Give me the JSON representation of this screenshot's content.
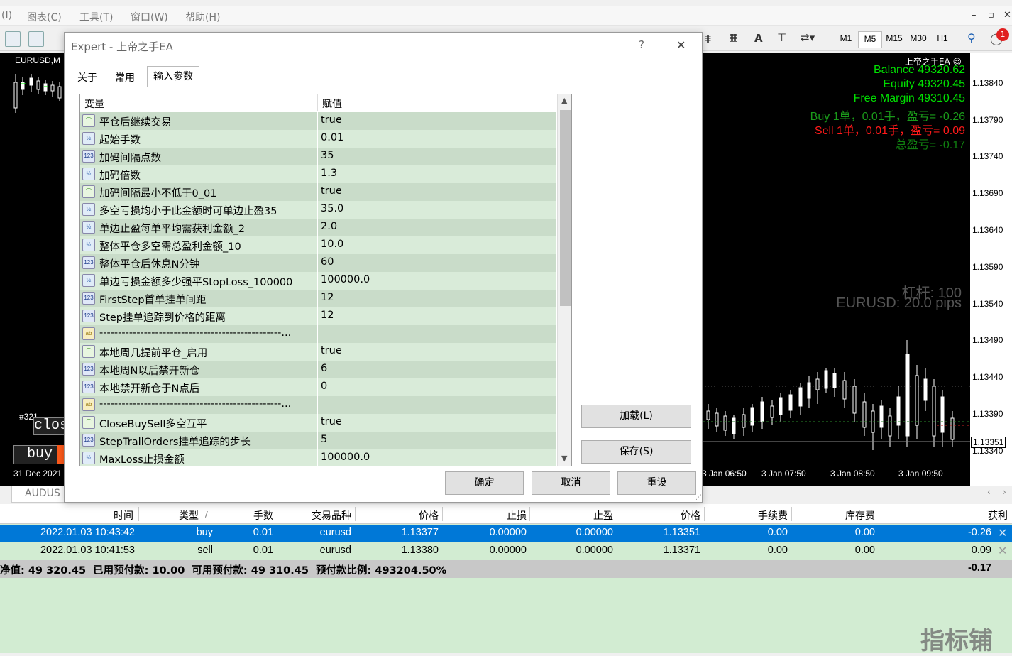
{
  "menubar": {
    "items": [
      "(I)",
      "图表(C)",
      "工具(T)",
      "窗口(W)",
      "帮助(H)"
    ]
  },
  "toolbar": {
    "timeframes": [
      "M1",
      "M5",
      "M15",
      "M30",
      "H1"
    ],
    "active_timeframe": "M5",
    "notification_count": "1"
  },
  "chart": {
    "symbol_label": "EURUSD,M",
    "ea_label": "上帝之手EA ☺",
    "hud": {
      "balance": "Balance 49320.62",
      "equity": "Equity 49320.45",
      "free_margin": "Free Margin 49310.45",
      "buy_line": "Buy 1单，0.01手，盈亏= -0.26",
      "sell_line": "Sell 1单，0.01手，盈亏= 0.09",
      "total_line": "总盈亏= -0.17",
      "leverage": "杠杆: 100",
      "spread": "EURUSD: 20.0 pips"
    },
    "price_ticks": [
      "1.13840",
      "1.13790",
      "1.13740",
      "1.13690",
      "1.13640",
      "1.13590",
      "1.13540",
      "1.13490",
      "1.13440",
      "1.13390",
      "1.13351",
      "1.13340"
    ],
    "time_ticks": [
      "3 Jan 06:50",
      "3 Jan 07:50",
      "3 Jan 08:50",
      "3 Jan 09:50"
    ],
    "left_time_label": "31 Dec 2021",
    "left_order_label": "#321",
    "left_close_btn": "close",
    "left_buy_btn": "buy",
    "bottom_tab": "AUDUS",
    "colors": {
      "balance": "#00e000",
      "buy": "#1a9a1a",
      "sell": "#ff1a1a",
      "total": "#108010",
      "axis_text": "#000000"
    }
  },
  "dialog": {
    "title": "Expert - 上帝之手EA",
    "help": "?",
    "close": "✕",
    "tabs": [
      "关于",
      "常用",
      "输入参数"
    ],
    "active_tab": "输入参数",
    "columns": {
      "variable": "变量",
      "value": "赋值"
    },
    "params": [
      {
        "icon": "bool-icon",
        "name": "平仓后继续交易",
        "value": "true"
      },
      {
        "icon": "double-icon",
        "name": "起始手数",
        "value": "0.01"
      },
      {
        "icon": "int-icon",
        "name": "加码间隔点数",
        "value": "35"
      },
      {
        "icon": "double-icon",
        "name": "加码倍数",
        "value": "1.3"
      },
      {
        "icon": "bool-icon",
        "name": "加码间隔最小不低于0_01",
        "value": "true"
      },
      {
        "icon": "double-icon",
        "name": "多空亏损均小于此金额时可单边止盈35",
        "value": "35.0"
      },
      {
        "icon": "double-icon",
        "name": "单边止盈每单平均需获利金额_2",
        "value": "2.0"
      },
      {
        "icon": "double-icon",
        "name": "整体平仓多空需总盈利金额_10",
        "value": "10.0"
      },
      {
        "icon": "int-icon",
        "name": "整体平仓后休息N分钟",
        "value": "60"
      },
      {
        "icon": "double-icon",
        "name": "单边亏损金额多少强平StopLoss_100000",
        "value": "100000.0"
      },
      {
        "icon": "int-icon",
        "name": "FirstStep首单挂单间距",
        "value": "12"
      },
      {
        "icon": "int-icon",
        "name": "Step挂单追踪到价格的距离",
        "value": "12"
      },
      {
        "icon": "string-icon",
        "name": "-------------------------------------------------...",
        "value": ""
      },
      {
        "icon": "bool-icon",
        "name": "本地周几提前平仓_启用",
        "value": "true"
      },
      {
        "icon": "int-icon",
        "name": "本地周N以后禁开新仓",
        "value": "6"
      },
      {
        "icon": "int-icon",
        "name": "本地禁开新仓于N点后",
        "value": "0"
      },
      {
        "icon": "string-icon",
        "name": "-------------------------------------------------...",
        "value": ""
      },
      {
        "icon": "bool-icon",
        "name": "CloseBuySell多空互平",
        "value": "true"
      },
      {
        "icon": "int-icon",
        "name": "StepTrallOrders挂单追踪的步长",
        "value": "5"
      },
      {
        "icon": "double-icon",
        "name": "MaxLoss止损金额",
        "value": "100000.0"
      }
    ],
    "buttons": {
      "load": "加载(L)",
      "save": "保存(S)",
      "ok": "确定",
      "cancel": "取消",
      "reset": "重设"
    }
  },
  "terminal": {
    "headers": [
      "时间",
      "类型",
      "手数",
      "交易品种",
      "价格",
      "止损",
      "止盈",
      "价格",
      "手续费",
      "库存费",
      "获利"
    ],
    "sort_marker": "/",
    "rows": [
      [
        "2022.01.03 10:43:42",
        "buy",
        "0.01",
        "eurusd",
        "1.13377",
        "0.00000",
        "0.00000",
        "1.13351",
        "0.00",
        "0.00",
        "-0.26"
      ],
      [
        "2022.01.03 10:41:53",
        "sell",
        "0.01",
        "eurusd",
        "1.13380",
        "0.00000",
        "0.00000",
        "1.13371",
        "0.00",
        "0.00",
        "0.09"
      ]
    ],
    "summary": "净值: 49 320.45  已用预付款: 10.00  可用预付款: 49 310.45  预付款比例: 493204.50%",
    "summary_total": "-0.17",
    "selected_row_color": "#0078d7"
  },
  "watermark": "指标铺"
}
